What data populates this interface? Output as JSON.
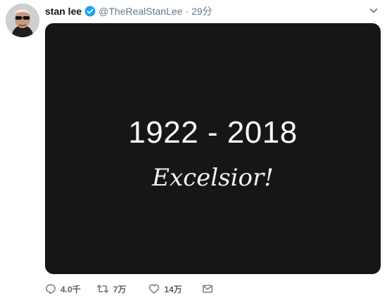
{
  "tweet": {
    "display_name": "stan lee",
    "handle": "@TheRealStanLee",
    "separator": "·",
    "timestamp": "29分",
    "verified": true,
    "media": {
      "years_text": "1922 - 2018",
      "motto_text": "Excelsior!",
      "background_color": "#161617"
    },
    "actions": {
      "reply": {
        "icon": "reply-icon",
        "count": "4.0千"
      },
      "retweet": {
        "icon": "retweet-icon",
        "count": "7万"
      },
      "like": {
        "icon": "heart-icon",
        "count": "14万"
      },
      "message": {
        "icon": "envelope-icon"
      }
    }
  },
  "colors": {
    "text_primary": "#14171a",
    "text_secondary": "#657786",
    "verified_blue": "#1da1f2"
  }
}
